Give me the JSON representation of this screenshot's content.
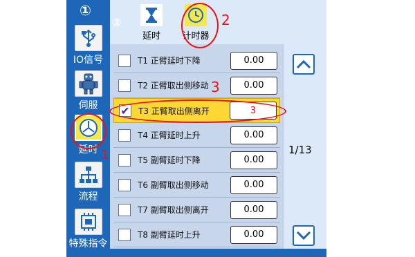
{
  "sidebar": {
    "step_marker": "①",
    "items": [
      {
        "label": "IO信号",
        "icon": "usb-icon"
      },
      {
        "label": "伺服",
        "icon": "robot-icon"
      },
      {
        "label": "延时",
        "icon": "timer-icon"
      },
      {
        "label": "流程",
        "icon": "flowchart-icon"
      },
      {
        "label": "特殊指令",
        "icon": "chip-icon"
      }
    ]
  },
  "header": {
    "step_marker": "②",
    "tabs": [
      {
        "label": "延时",
        "icon": "hourglass-icon"
      },
      {
        "label": "计时器",
        "icon": "clock-icon"
      }
    ]
  },
  "timers": [
    {
      "id": "T1",
      "name": "正臂延时下降",
      "value": "0.00",
      "checked": false
    },
    {
      "id": "T2",
      "name": "正臂取出侧移动",
      "value": "0.00",
      "checked": false
    },
    {
      "id": "T3",
      "name": "正臂取出侧离开",
      "value": "3",
      "checked": true
    },
    {
      "id": "T4",
      "name": "正臂延时上升",
      "value": "0.00",
      "checked": false
    },
    {
      "id": "T5",
      "name": "副臂延时下降",
      "value": "0.00",
      "checked": false
    },
    {
      "id": "T6",
      "name": "副臂取出侧移动",
      "value": "0.00",
      "checked": false
    },
    {
      "id": "T7",
      "name": "副臂取出侧离开",
      "value": "0.00",
      "checked": false
    },
    {
      "id": "T8",
      "name": "副臂延时上升",
      "value": "0.00",
      "checked": false
    }
  ],
  "pager": {
    "text": "1/13"
  },
  "annotations": {
    "n1": "1",
    "n2": "2",
    "n3": "3"
  },
  "colors": {
    "brand_blue": "#1e66b7",
    "highlight_yellow": "#fdd835",
    "annotation_red": "#e11111"
  }
}
